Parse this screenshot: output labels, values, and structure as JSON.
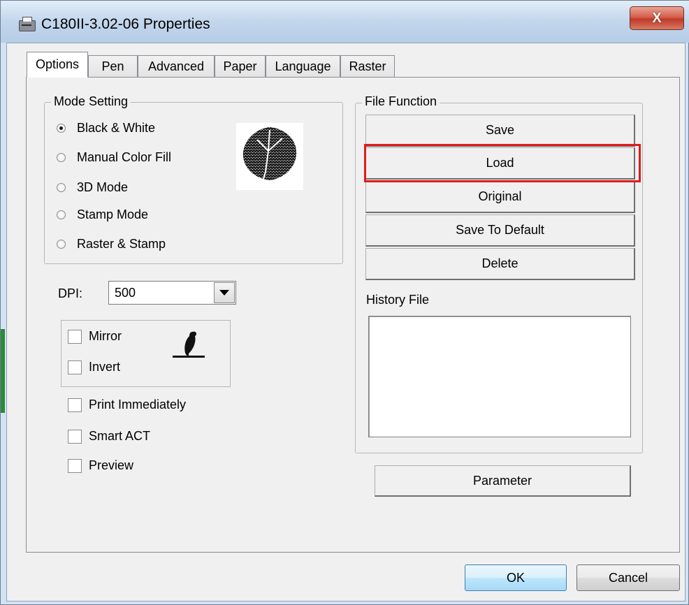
{
  "window": {
    "title": "C180II-3.02-06 Properties",
    "close_label": "X"
  },
  "tabs": [
    {
      "label": "Options",
      "active": true
    },
    {
      "label": "Pen"
    },
    {
      "label": "Advanced"
    },
    {
      "label": "Paper"
    },
    {
      "label": "Language"
    },
    {
      "label": "Raster"
    }
  ],
  "mode_setting": {
    "title": "Mode Setting",
    "options": [
      {
        "label": "Black & White",
        "checked": true
      },
      {
        "label": "Manual Color Fill",
        "checked": false
      },
      {
        "label": "3D Mode",
        "checked": false
      },
      {
        "label": "Stamp Mode",
        "checked": false
      },
      {
        "label": "Raster & Stamp",
        "checked": false
      }
    ],
    "preview_icon": "leaf-image-icon"
  },
  "dpi": {
    "label": "DPI:",
    "value": "500"
  },
  "image_options": {
    "mirror": {
      "label": "Mirror",
      "checked": false
    },
    "invert": {
      "label": "Invert",
      "checked": false
    },
    "preview_icon": "bird-silhouette-icon"
  },
  "extra_options": [
    {
      "label": "Print Immediately",
      "checked": false
    },
    {
      "label": "Smart ACT",
      "checked": false
    },
    {
      "label": "Preview",
      "checked": false
    }
  ],
  "file_function": {
    "title": "File Function",
    "buttons": [
      "Save",
      "Load",
      "Original",
      "Save To Default",
      "Delete"
    ],
    "history_label": "History File",
    "highlight_color": "#e01b1b"
  },
  "parameter_button": "Parameter",
  "dialog_buttons": {
    "ok": "OK",
    "cancel": "Cancel"
  }
}
